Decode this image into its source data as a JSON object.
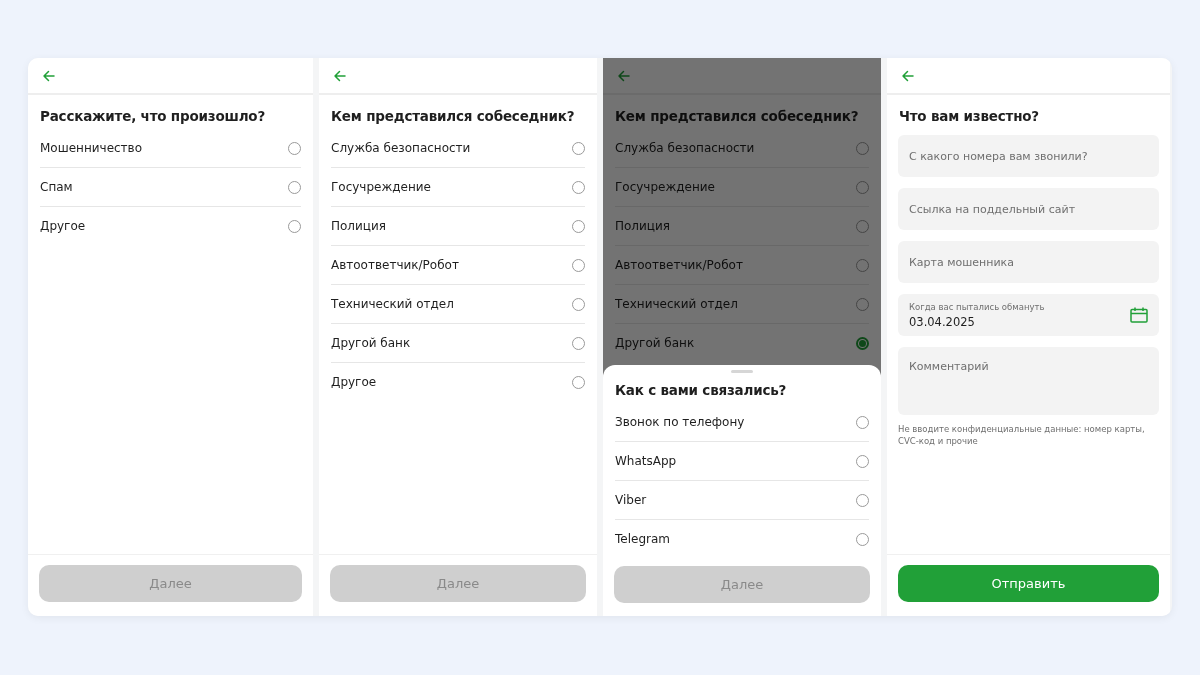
{
  "screens": [
    {
      "kind": "choice",
      "title": "Расскажите, что произошло?",
      "options": [
        {
          "label": "Мошенничество",
          "selected": false
        },
        {
          "label": "Спам",
          "selected": false
        },
        {
          "label": "Другое",
          "selected": false
        }
      ],
      "button": {
        "label": "Далее",
        "disabled": true
      }
    },
    {
      "kind": "choice",
      "title": "Кем представился собеседник?",
      "options": [
        {
          "label": "Служба безопасности",
          "selected": false
        },
        {
          "label": "Госучреждение",
          "selected": false
        },
        {
          "label": "Полиция",
          "selected": false
        },
        {
          "label": "Автоответчик/Робот",
          "selected": false
        },
        {
          "label": "Технический отдел",
          "selected": false
        },
        {
          "label": "Другой банк",
          "selected": false
        },
        {
          "label": "Другое",
          "selected": false
        }
      ],
      "button": {
        "label": "Далее",
        "disabled": true
      }
    },
    {
      "kind": "choice",
      "title": "Кем представился собеседник?",
      "options": [
        {
          "label": "Служба безопасности",
          "selected": false
        },
        {
          "label": "Госучреждение",
          "selected": false
        },
        {
          "label": "Полиция",
          "selected": false
        },
        {
          "label": "Автоответчик/Робот",
          "selected": false
        },
        {
          "label": "Технический отдел",
          "selected": false
        },
        {
          "label": "Другой банк",
          "selected": true
        }
      ],
      "sheet": {
        "title": "Как с вами связались?",
        "options": [
          {
            "label": "Звонок по телефону",
            "selected": false
          },
          {
            "label": "WhatsApp",
            "selected": false
          },
          {
            "label": "Viber",
            "selected": false
          },
          {
            "label": "Telegram",
            "selected": false
          }
        ],
        "button": {
          "label": "Далее",
          "disabled": true
        }
      }
    },
    {
      "kind": "form",
      "title": "Что вам известно?",
      "fields": [
        {
          "kind": "text",
          "placeholder": "С какого номера вам звонили?"
        },
        {
          "kind": "text",
          "placeholder": "Ссылка на поддельный сайт"
        },
        {
          "kind": "text",
          "placeholder": "Карта мошенника"
        },
        {
          "kind": "date",
          "label": "Когда вас пытались обмануть",
          "value": "03.04.2025"
        },
        {
          "kind": "textarea",
          "placeholder": "Комментарий"
        }
      ],
      "hint": "Не вводите конфиденциальные данные: номер карты, CVC-код и прочие",
      "button": {
        "label": "Отправить",
        "disabled": false
      }
    }
  ]
}
